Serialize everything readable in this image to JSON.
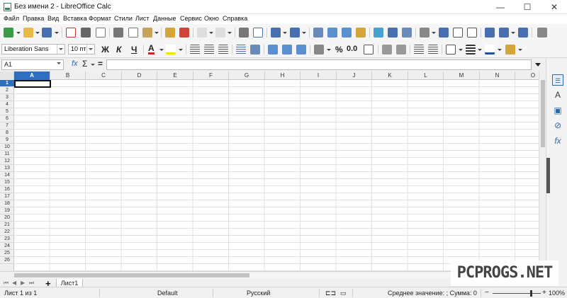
{
  "window": {
    "title": "Без имени 2 - LibreOffice Calc",
    "minimize": "—",
    "maximize": "☐",
    "close": "✕"
  },
  "menu": [
    "Файл",
    "Правка",
    "Вид",
    "Вставка",
    "Формат",
    "Стили",
    "Лист",
    "Данные",
    "Сервис",
    "Окно",
    "Справка"
  ],
  "formatting": {
    "font_name": "Liberation Sans",
    "font_size": "10 пт",
    "bold": "Ж",
    "italic": "К",
    "underline": "Ч",
    "percent": "%",
    "number": "0.0",
    "font_color_label": "А"
  },
  "formula_bar": {
    "name_box": "A1",
    "function_wizard": "fx",
    "sum": "Σ",
    "equals": "=",
    "content": ""
  },
  "grid": {
    "columns": [
      "A",
      "B",
      "C",
      "D",
      "E",
      "F",
      "G",
      "H",
      "I",
      "J",
      "K",
      "L",
      "M",
      "N",
      "O"
    ],
    "rows": [
      "1",
      "2",
      "3",
      "4",
      "5",
      "6",
      "7",
      "8",
      "9",
      "10",
      "11",
      "12",
      "13",
      "14",
      "15",
      "16",
      "17",
      "18",
      "19",
      "20",
      "21",
      "22",
      "23",
      "24",
      "25",
      "26"
    ],
    "active_cell": "A1"
  },
  "sheets": {
    "tabs": [
      "Лист1"
    ],
    "add": "+"
  },
  "status": {
    "sheet_position": "Лист 1 из 1",
    "page_style": "Default",
    "language": "Русский",
    "summary": "Среднее значение: ; Сумма: 0",
    "zoom": "100%",
    "zoom_minus": "−",
    "zoom_plus": "+"
  },
  "sidebar_icons": [
    "properties-icon",
    "styles-icon",
    "gallery-icon",
    "navigator-icon",
    "functions-icon"
  ],
  "watermark": "PCPROGS.NET",
  "colors": {
    "active_header": "#2f6fc0",
    "accent_green": "#2e8b57"
  }
}
